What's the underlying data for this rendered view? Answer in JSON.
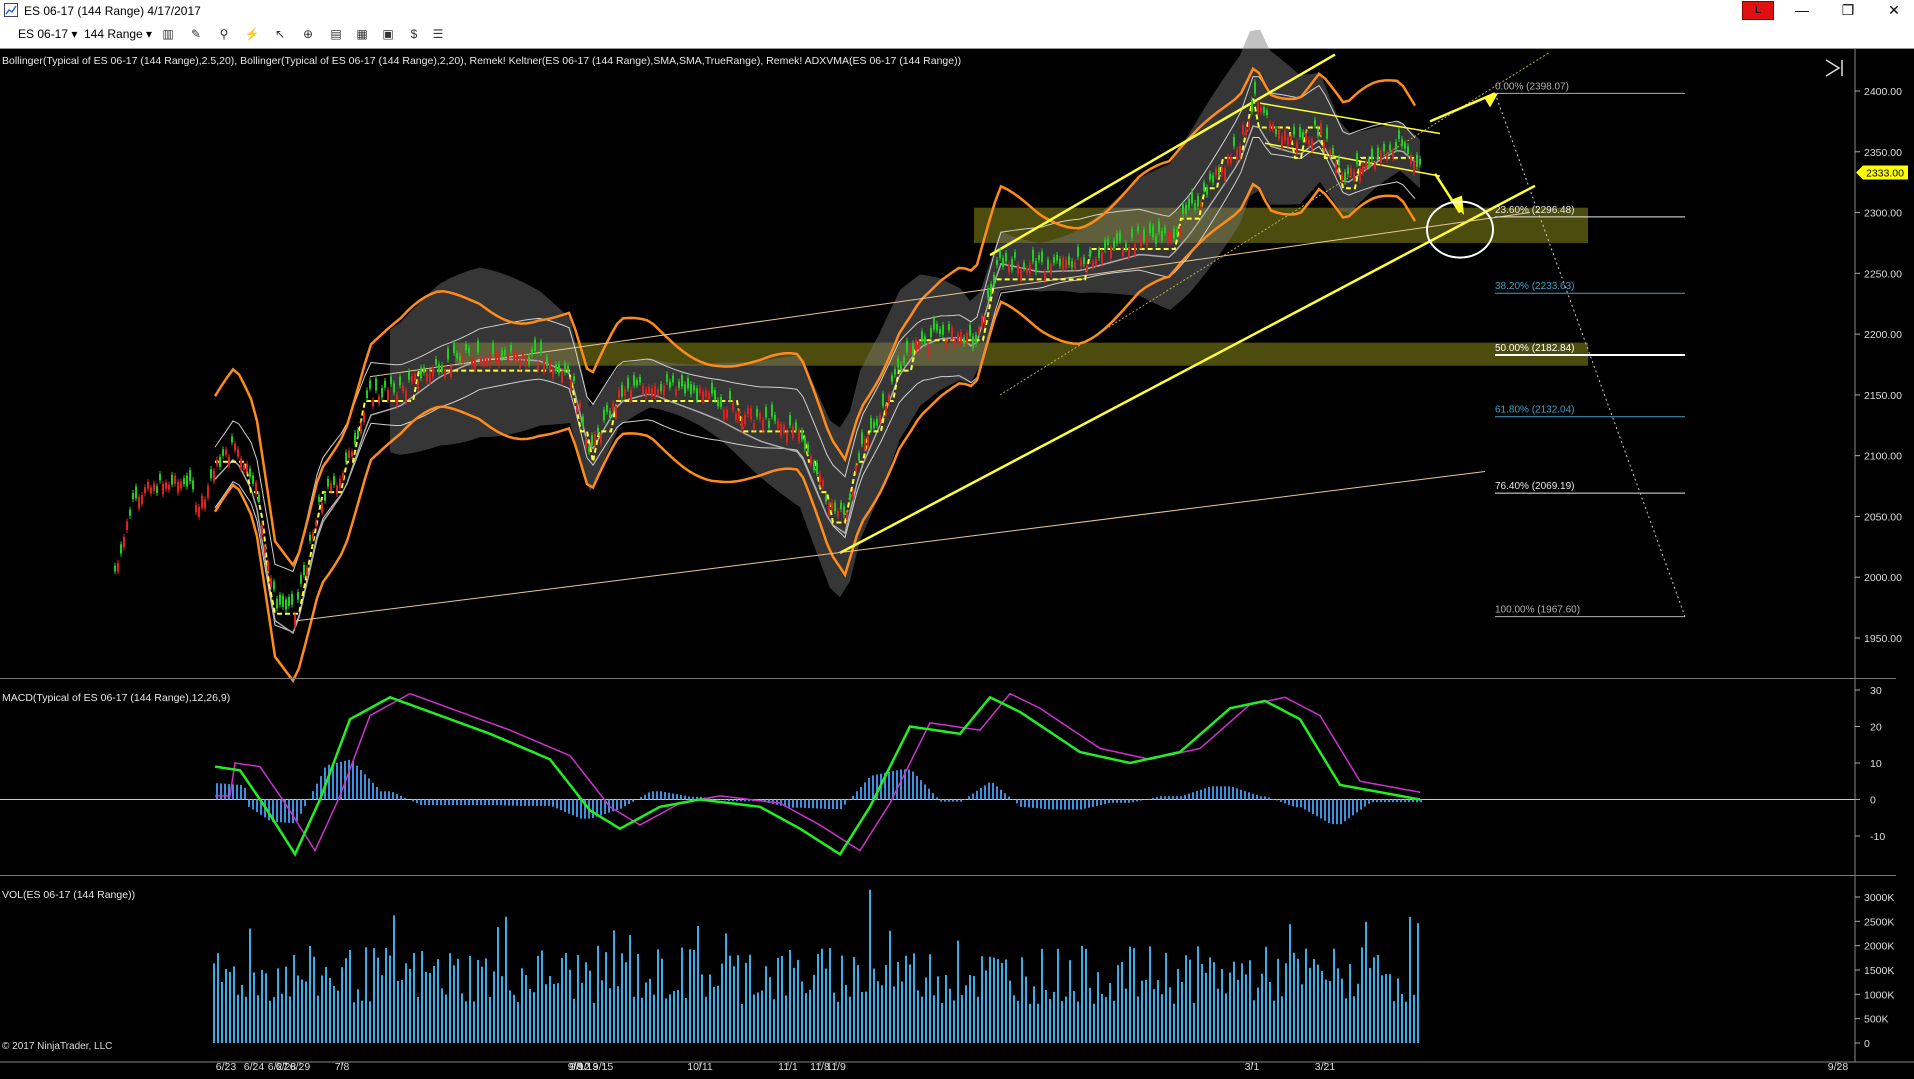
{
  "window": {
    "title": "ES 06-17 (144 Range)  4/17/2017",
    "account_badge": "L",
    "controls": [
      "—",
      "❐",
      "✕"
    ]
  },
  "toolbar": {
    "instrument": "ES 06-17",
    "interval": "144 Range"
  },
  "price_panel": {
    "indicators_label": "Bollinger(Typical of ES 06-17 (144 Range),2.5,20), Bollinger(Typical of ES 06-17 (144 Range),2,20), Remek! Keltner(ES 06-17 (144 Range),SMA,SMA,TrueRange), Remek! ADXVMA(ES 06-17 (144 Range))",
    "y_ticks": [
      "2400.00",
      "2350.00",
      "2300.00",
      "2250.00",
      "2200.00",
      "2150.00",
      "2100.00",
      "2050.00",
      "2000.00",
      "1950.00"
    ],
    "last_price": "2333.00",
    "fib_levels": [
      {
        "label": "0.00% (2398.07)",
        "color": "#b0b0b0"
      },
      {
        "label": "23.60% (2296.48)",
        "color": "#e8e8e8"
      },
      {
        "label": "38.20% (2233.63)",
        "color": "#3fa0c8"
      },
      {
        "label": "50.00% (2182.84)",
        "color": "#ffffff"
      },
      {
        "label": "61.80% (2132.04)",
        "color": "#3fa0c8"
      },
      {
        "label": "76.40% (2069.19)",
        "color": "#e8e8e8"
      },
      {
        "label": "100.00% (1967.60)",
        "color": "#b0b0b0"
      }
    ]
  },
  "macd_panel": {
    "label": "MACD(Typical of ES 06-17 (144 Range),12,26,9)",
    "y_ticks": [
      "30",
      "20",
      "10",
      "0",
      "-10"
    ]
  },
  "volume_panel": {
    "label": "VOL(ES 06-17 (144 Range))",
    "y_ticks": [
      "3000K",
      "2500K",
      "2000K",
      "1500K",
      "1000K",
      "500K",
      "0"
    ]
  },
  "x_axis": {
    "dates": [
      "6/23",
      "6/24",
      "6/27",
      "6/28",
      "6/29",
      "7/8",
      "9/8",
      "9/12",
      "9/13",
      "9/15",
      "10/11",
      "11/1",
      "11/8",
      "11/9",
      "3/1",
      "3/21",
      "9/28"
    ]
  },
  "copyright": "© 2017 NinjaTrader, LLC",
  "colors": {
    "candle_up": "#22cc22",
    "candle_down": "#dd2222",
    "keltner": "#ff8c1a",
    "adxvma": "#ffff33",
    "adxvma_alt": "#33ddee",
    "macd_line": "#22ee22",
    "signal_line": "#cc33cc",
    "histogram": "#3d8fe0",
    "volume": "#3aaee8",
    "channel": "#ffff33",
    "zone": "#8a8a1a"
  }
}
